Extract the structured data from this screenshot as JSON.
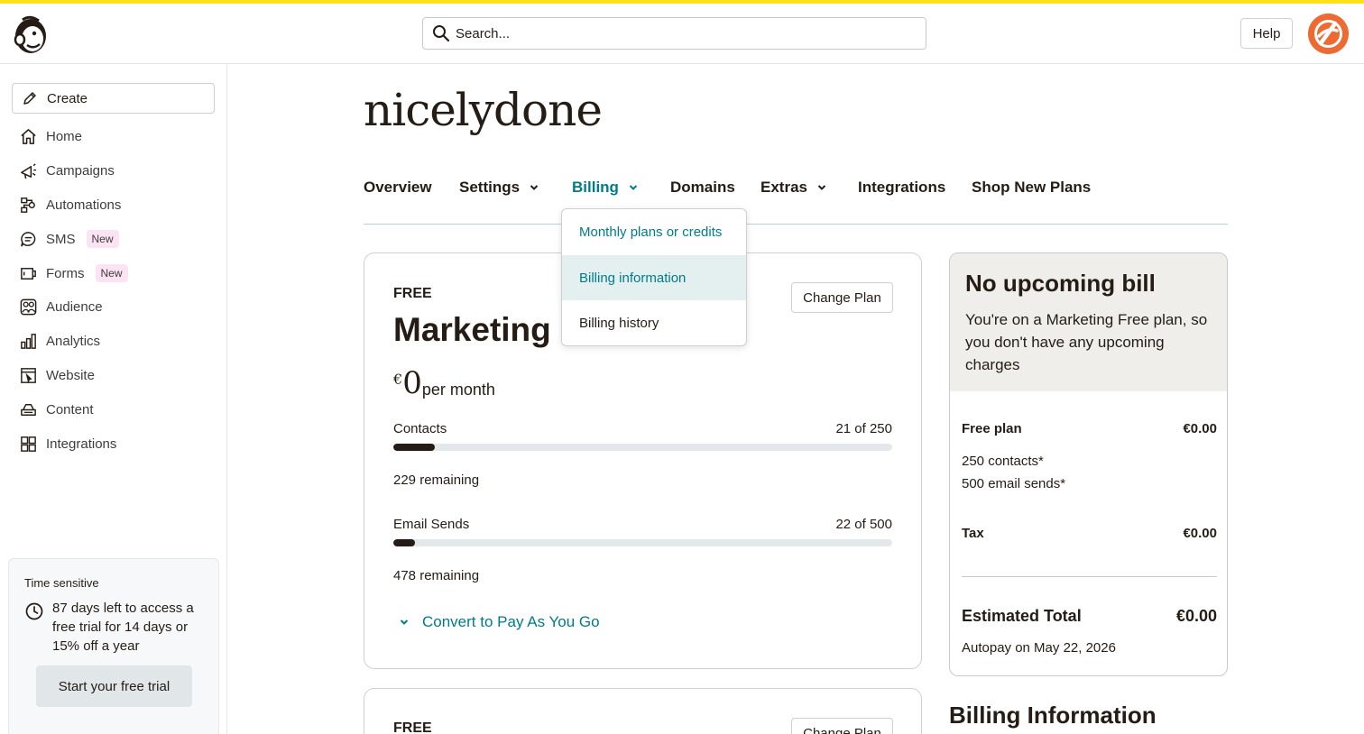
{
  "header": {
    "search_placeholder": "Search...",
    "help_label": "Help"
  },
  "sidebar": {
    "create_label": "Create",
    "items": [
      {
        "label": "Home",
        "icon": "home-icon"
      },
      {
        "label": "Campaigns",
        "icon": "megaphone-icon"
      },
      {
        "label": "Automations",
        "icon": "automations-icon"
      },
      {
        "label": "SMS",
        "icon": "sms-icon",
        "badge": "New"
      },
      {
        "label": "Forms",
        "icon": "forms-icon",
        "badge": "New"
      },
      {
        "label": "Audience",
        "icon": "audience-icon"
      },
      {
        "label": "Analytics",
        "icon": "analytics-icon"
      },
      {
        "label": "Website",
        "icon": "website-icon"
      },
      {
        "label": "Content",
        "icon": "content-icon"
      },
      {
        "label": "Integrations",
        "icon": "integrations-icon"
      }
    ],
    "time_card": {
      "heading": "Time sensitive",
      "message": "87 days left to access a free trial for 14 days or 15% off a year",
      "button_label": "Start your free trial"
    }
  },
  "account": {
    "title": "nicelydone"
  },
  "tabs": [
    {
      "label": "Overview",
      "has_menu": false
    },
    {
      "label": "Settings",
      "has_menu": true
    },
    {
      "label": "Billing",
      "has_menu": true,
      "active": true
    },
    {
      "label": "Domains",
      "has_menu": false
    },
    {
      "label": "Extras",
      "has_menu": true
    },
    {
      "label": "Integrations",
      "has_menu": false
    },
    {
      "label": "Shop New Plans",
      "has_menu": false
    }
  ],
  "billing_menu": {
    "items": [
      "Monthly plans or credits",
      "Billing information",
      "Billing history"
    ],
    "highlighted": "Billing information"
  },
  "plan_card": {
    "tier": "FREE",
    "name": "Marketing Free",
    "change_label": "Change Plan",
    "currency": "€",
    "price": "0",
    "period": "per month",
    "contacts": {
      "label": "Contacts",
      "value": "21 of 250",
      "used": 21,
      "limit": 250,
      "remaining": "229 remaining"
    },
    "email_sends": {
      "label": "Email Sends",
      "value": "22 of 500",
      "used": 22,
      "limit": 500,
      "remaining": "478 remaining"
    },
    "convert_label": "Convert to Pay As You Go"
  },
  "plan_card_2": {
    "tier": "FREE",
    "change_label": "Change Plan"
  },
  "bill_summary": {
    "title": "No upcoming bill",
    "description": "You're on a Marketing Free plan, so you don't have any upcoming charges",
    "plan_label": "Free plan",
    "plan_amount": "€0.00",
    "contacts": "250 contacts*",
    "email_sends": "500 email sends*",
    "tax_label": "Tax",
    "tax_amount": "€0.00",
    "total_label": "Estimated Total",
    "total_amount": "€0.00",
    "autopay": "Autopay on May 22, 2026"
  },
  "billing_info_title": "Billing Information",
  "colors": {
    "accent": "#007c89",
    "brand_yellow": "#ffe01b",
    "avatar": "#ee6a33",
    "badge_new": "#fbe3f3"
  }
}
